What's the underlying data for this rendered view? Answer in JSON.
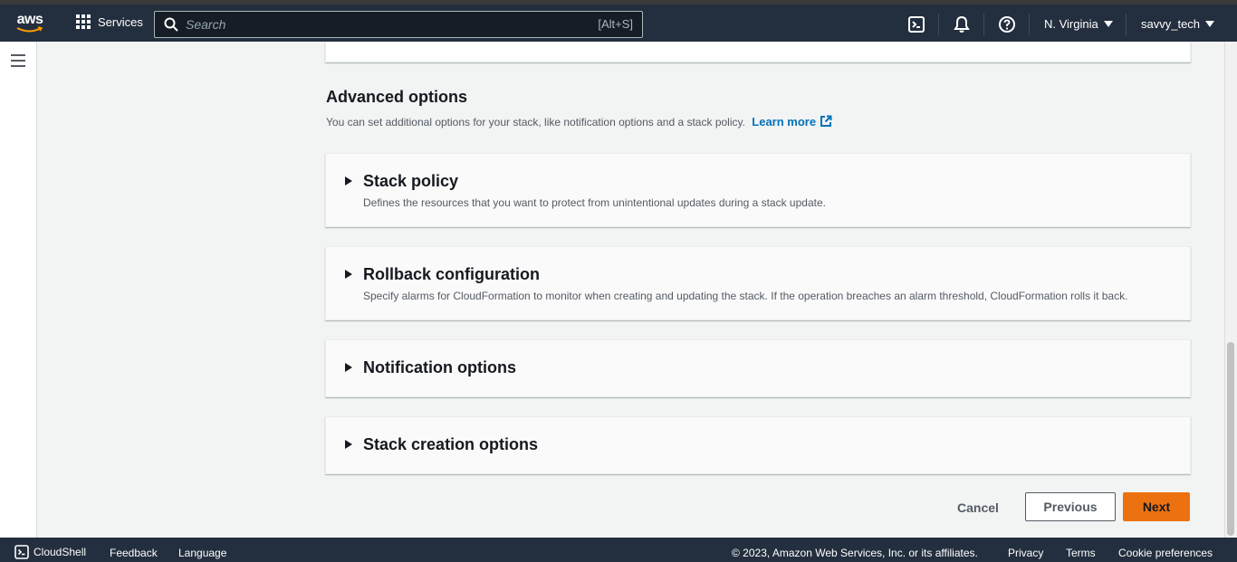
{
  "header": {
    "logo_text": "aws",
    "services_label": "Services",
    "search_placeholder": "Search",
    "search_shortcut": "[Alt+S]",
    "region": "N. Virginia",
    "account": "savvy_tech"
  },
  "advanced": {
    "title": "Advanced options",
    "description": "You can set additional options for your stack, like notification options and a stack policy.",
    "learn_more": "Learn more"
  },
  "panels": [
    {
      "title": "Stack policy",
      "description": "Defines the resources that you want to protect from unintentional updates during a stack update."
    },
    {
      "title": "Rollback configuration",
      "description": "Specify alarms for CloudFormation to monitor when creating and updating the stack. If the operation breaches an alarm threshold, CloudFormation rolls it back."
    },
    {
      "title": "Notification options",
      "description": ""
    },
    {
      "title": "Stack creation options",
      "description": ""
    }
  ],
  "actions": {
    "cancel": "Cancel",
    "previous": "Previous",
    "next": "Next"
  },
  "footer": {
    "cloudshell": "CloudShell",
    "feedback": "Feedback",
    "language": "Language",
    "copyright": "© 2023, Amazon Web Services, Inc. or its affiliates.",
    "privacy": "Privacy",
    "terms": "Terms",
    "cookie": "Cookie preferences"
  },
  "colors": {
    "header_bg": "#232f3e",
    "primary_button": "#ec7211",
    "link": "#0073bb",
    "page_bg": "#f2f3f3"
  }
}
